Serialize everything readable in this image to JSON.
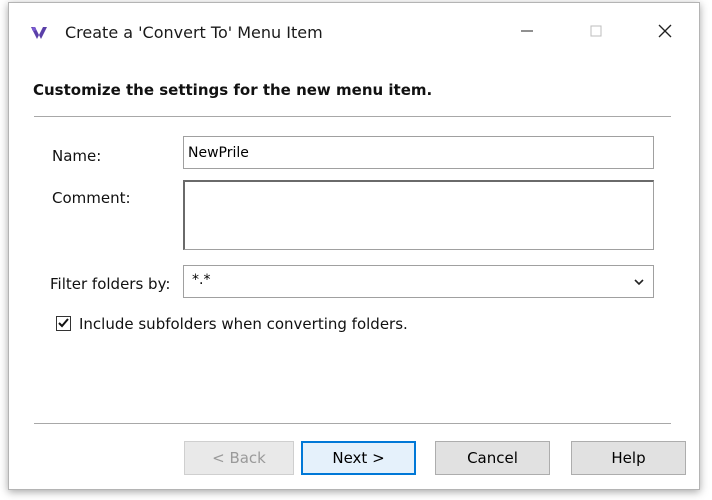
{
  "window": {
    "title": "Create a 'Convert To' Menu Item",
    "controls": {
      "minimize_icon": "minimize-icon",
      "maximize_icon": "maximize-icon",
      "close_icon": "close-icon"
    },
    "app_icon": "app-logo-icon"
  },
  "header": {
    "text": "Customize the settings for the new menu item."
  },
  "form": {
    "name_label": "Name:",
    "name_value": "NewPrile",
    "comment_label": "Comment:",
    "comment_value": "",
    "filter_label": "Filter folders by:",
    "filter_value": "*.*",
    "include_subfolders_label": "Include subfolders when converting folders.",
    "include_subfolders_checked": true
  },
  "buttons": {
    "back": "< Back",
    "next": "Next >",
    "cancel": "Cancel",
    "help": "Help"
  },
  "colors": {
    "accent": "#0078d7",
    "button_bg": "#e1e1e1",
    "separator": "#a8a8a8"
  }
}
